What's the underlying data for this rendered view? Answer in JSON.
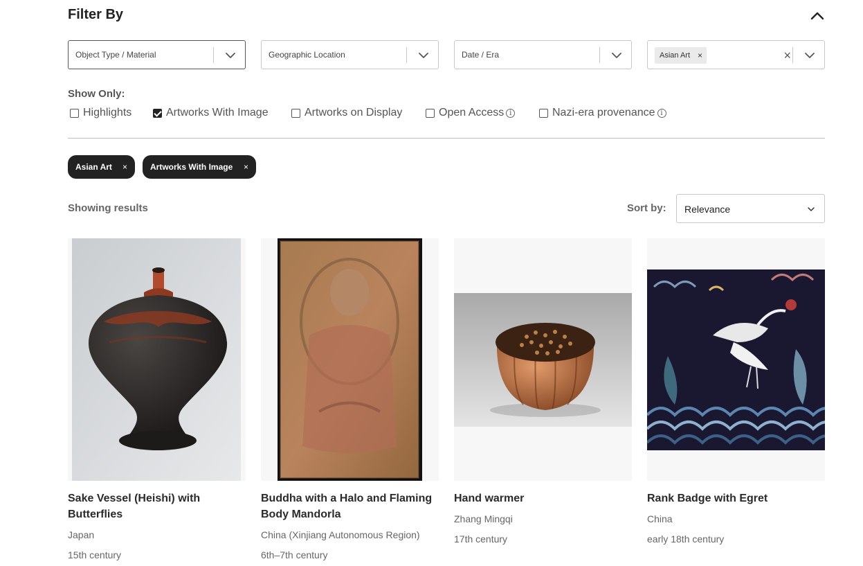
{
  "filter": {
    "title": "Filter By",
    "dropdowns": [
      {
        "placeholder": "Object Type / Material"
      },
      {
        "placeholder": "Geographic Location"
      },
      {
        "placeholder": "Date / Era"
      }
    ],
    "department_select": {
      "selected_chip": "Asian Art",
      "chip_remove": "×",
      "clear": "×"
    }
  },
  "show_only": {
    "label": "Show Only:",
    "options": [
      {
        "label": "Highlights",
        "checked": false
      },
      {
        "label": "Artworks With Image",
        "checked": true
      },
      {
        "label": "Artworks on Display",
        "checked": false
      },
      {
        "label": "Open Access",
        "checked": false,
        "info": "i"
      },
      {
        "label": "Nazi-era provenance",
        "checked": false,
        "info": "i"
      }
    ]
  },
  "active_filters": [
    {
      "label": "Asian Art",
      "remove": "×"
    },
    {
      "label": "Artworks With Image",
      "remove": "×"
    }
  ],
  "results": {
    "showing_label": "Showing results",
    "sort_label": "Sort by:",
    "sort_value": "Relevance"
  },
  "cards": [
    {
      "title": "Sake Vessel (Heishi) with Butterflies",
      "subtitle": "Japan",
      "date": "15th century",
      "image_icon": "black-lacquer-vessel"
    },
    {
      "title": "Buddha with a Halo and Flaming Body Mandorla",
      "subtitle": "China (Xinjiang Autonomous Region)",
      "date": "6th–7th century",
      "image_icon": "painted-wood-panel"
    },
    {
      "title": "Hand warmer",
      "subtitle": "Zhang Mingqi",
      "date": "17th century",
      "image_icon": "copper-lobed-pot"
    },
    {
      "title": "Rank Badge with Egret",
      "subtitle": "China",
      "date": "early 18th century",
      "image_icon": "embroidered-egret-badge"
    }
  ],
  "colors": {
    "dark_pill": "#222222",
    "border": "#c7c7c7",
    "muted_text": "#666666"
  }
}
